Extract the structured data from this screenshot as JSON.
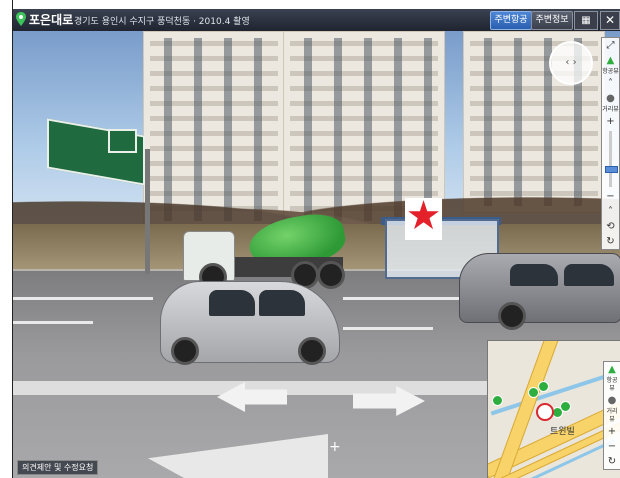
{
  "header": {
    "road_name": "포은대로",
    "address": "경기도 용인시 수지구 풍덕천동 · 2010.4 촬영",
    "btn_around": "주변항공",
    "btn_info": "주변정보",
    "layout_icon": "▦",
    "close_icon": "✕"
  },
  "scene": {
    "marker_icon": "★",
    "nav_icon": "‹ ›",
    "crosshair_icon": "+"
  },
  "controls": {
    "fullscreen": "⤢",
    "aerial_label": "항공뷰",
    "up": "˄",
    "street_label": "거리뷰",
    "zoom_in": "+",
    "zoom_out": "−",
    "up2": "˄",
    "rotate": "⟲",
    "refresh": "↻",
    "zoom_level": 0.3
  },
  "minimap": {
    "label": "트윈빌",
    "aerial_label": "항공뷰",
    "street_label": "거리뷰",
    "zoom_in": "+",
    "zoom_out": "−",
    "refresh": "↻"
  },
  "footer": {
    "feedback": "의견제안 및 수정요청"
  },
  "colors": {
    "accent": "#2a5fae",
    "marker": "#e4202a",
    "pin": "#2fae40"
  }
}
